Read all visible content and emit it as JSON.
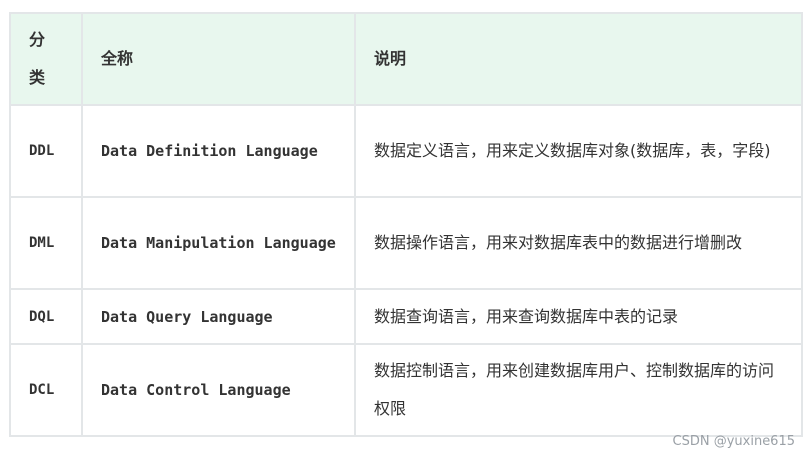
{
  "table": {
    "headers": {
      "category": "分类",
      "fullname": "全称",
      "description": "说明"
    },
    "rows": [
      {
        "abbr": "DDL",
        "fullname": "Data Definition Language",
        "description": "数据定义语言，用来定义数据库对象(数据库，表，字段)"
      },
      {
        "abbr": "DML",
        "fullname": "Data Manipulation Language",
        "description": "数据操作语言，用来对数据库表中的数据进行增删改"
      },
      {
        "abbr": "DQL",
        "fullname": "Data Query Language",
        "description": "数据查询语言，用来查询数据库中表的记录"
      },
      {
        "abbr": "DCL",
        "fullname": "Data Control Language",
        "description": "数据控制语言，用来创建数据库用户、控制数据库的访问权限"
      }
    ]
  },
  "watermark": "CSDN @yuxine615"
}
